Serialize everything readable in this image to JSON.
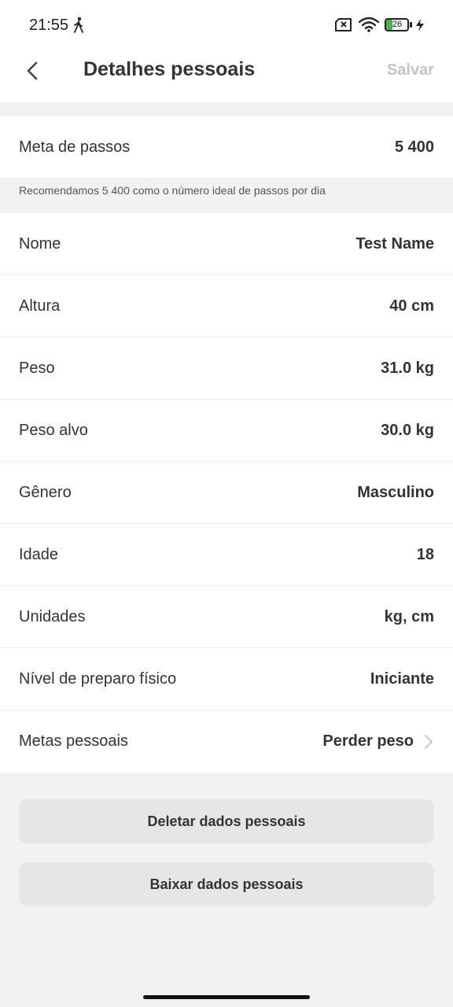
{
  "status_bar": {
    "time": "21:55",
    "battery_percent": "26",
    "icons": [
      "walk-icon",
      "sim-icon",
      "wifi-icon",
      "battery-icon",
      "charging-bolt-icon"
    ]
  },
  "header": {
    "title": "Detalhes pessoais",
    "save_label": "Salvar",
    "back_icon": "chevron-left-icon"
  },
  "step_goal": {
    "label": "Meta de passos",
    "value": "5 400",
    "hint": "Recomendamos 5 400 como o número ideal de passos por dia"
  },
  "details": [
    {
      "label": "Nome",
      "value": "Test Name"
    },
    {
      "label": "Altura",
      "value": "40 cm"
    },
    {
      "label": "Peso",
      "value": "31.0 kg"
    },
    {
      "label": "Peso alvo",
      "value": "30.0 kg"
    },
    {
      "label": "Gênero",
      "value": "Masculino"
    },
    {
      "label": "Idade",
      "value": "18"
    },
    {
      "label": "Unidades",
      "value": "kg, cm"
    },
    {
      "label": "Nível de preparo físico",
      "value": "Iniciante"
    },
    {
      "label": "Metas pessoais",
      "value": "Perder peso"
    }
  ],
  "actions": {
    "delete_label": "Deletar dados pessoais",
    "download_label": "Baixar dados pessoais"
  },
  "colors": {
    "background": "#f2f2f2",
    "card": "#ffffff",
    "button": "#e6e6e6",
    "text": "#333333",
    "muted": "#c4c4c4",
    "battery": "#4caf50"
  }
}
